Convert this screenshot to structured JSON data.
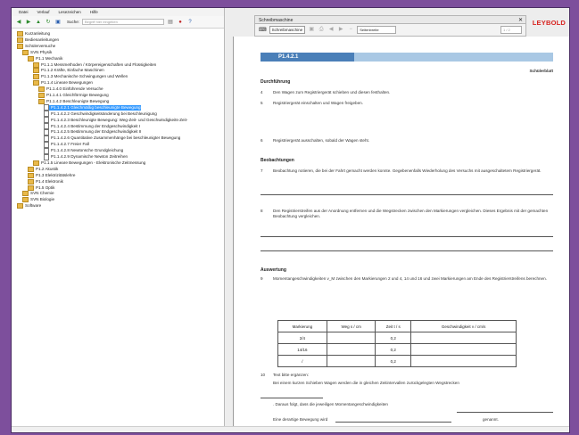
{
  "menu": [
    "Datei",
    "Verlauf",
    "Lesezeichen",
    "Hilfe"
  ],
  "toolbar": {
    "search_label": "Suche:",
    "search_placeholder": "Begriff hier eingeben"
  },
  "tree": [
    {
      "label": "Kurzanleitung",
      "depth": 0,
      "kind": "folder"
    },
    {
      "label": "Bedienanleitungen",
      "depth": 0,
      "kind": "folder"
    },
    {
      "label": "Schülerversuche",
      "depth": 0,
      "kind": "folder"
    },
    {
      "label": "SVN Physik",
      "depth": 1,
      "kind": "folder"
    },
    {
      "label": "P1.1 Mechanik",
      "depth": 2,
      "kind": "folder"
    },
    {
      "label": "P1.1.1 Messmethoden / Körpereigenschaften und Flüssigkeiten",
      "depth": 3,
      "kind": "folder"
    },
    {
      "label": "P1.1.2 Kräfte, Einfache Maschinen",
      "depth": 3,
      "kind": "folder"
    },
    {
      "label": "P1.1.3 Mechanische Schwingungen und Wellen",
      "depth": 3,
      "kind": "folder"
    },
    {
      "label": "P1.1.4 Lineare Bewegungen",
      "depth": 3,
      "kind": "folder"
    },
    {
      "label": "P1.1.4.0 Einführende Versuche",
      "depth": 4,
      "kind": "folder"
    },
    {
      "label": "P1.1.4.1 Gleichförmige Bewegung",
      "depth": 4,
      "kind": "folder"
    },
    {
      "label": "P1.1.4.2 Beschleunigte Bewegung",
      "depth": 4,
      "kind": "folder"
    },
    {
      "label": "P1.1.4.2.1 Gleichmäßig beschleunigte Bewegung",
      "depth": 5,
      "kind": "doc",
      "selected": true
    },
    {
      "label": "P1.1.4.2.2 Geschwindigkeitsänderung bei Beschleunigung",
      "depth": 5,
      "kind": "doc"
    },
    {
      "label": "P1.1.4.2.3 Beschleunigte Bewegung: Weg-Zeit- und Geschwindigkeits-Zeit-",
      "depth": 5,
      "kind": "doc"
    },
    {
      "label": "P1.1.4.2.4 Bestimmung der Endgeschwindigkeit I",
      "depth": 5,
      "kind": "doc"
    },
    {
      "label": "P1.1.4.2.5 Bestimmung der Endgeschwindigkeit II",
      "depth": 5,
      "kind": "doc"
    },
    {
      "label": "P1.1.4.2.6 Quantitative Zusammenhänge bei beschleunigter Bewegung",
      "depth": 5,
      "kind": "doc"
    },
    {
      "label": "P1.1.4.2.7 Freier Fall",
      "depth": 5,
      "kind": "doc"
    },
    {
      "label": "P1.1.4.2.8 Newtonsche Grundgleichung",
      "depth": 5,
      "kind": "doc"
    },
    {
      "label": "P1.1.4.2.9 Dynamische Newton Zeitreihen",
      "depth": 5,
      "kind": "doc"
    },
    {
      "label": "P1.1.5 Lineare Bewegungen - Elektronische Zeitmessung",
      "depth": 3,
      "kind": "folder"
    },
    {
      "label": "P1.2 Akustik",
      "depth": 2,
      "kind": "folder"
    },
    {
      "label": "P1.3 Elektrizitätslehre",
      "depth": 2,
      "kind": "folder"
    },
    {
      "label": "P1.4 Elektronik",
      "depth": 2,
      "kind": "folder"
    },
    {
      "label": "P1.5 Optik",
      "depth": 2,
      "kind": "folder"
    },
    {
      "label": "SVN Chemie",
      "depth": 1,
      "kind": "folder"
    },
    {
      "label": "SVN Biologie",
      "depth": 1,
      "kind": "folder"
    },
    {
      "label": "Software",
      "depth": 0,
      "kind": "folder"
    }
  ],
  "viewer": {
    "title": "Schreibmaschine",
    "save_button": "Schreibmaschine",
    "zoom": "Seitenbreite",
    "page_input": "1 / 2",
    "logo": "LEYBOLD"
  },
  "doc": {
    "code": "P1.4.2.1",
    "sheet_label": "Schülerblatt",
    "sec_durchfuehrung": "Durchführung",
    "step4": "Den Wagen zum Registriergerät schieben und diesen festhalten.",
    "step5": "Registriergerät einschalten und Wagen freigeben.",
    "step6": "Registriergerät ausschalten, sobald der Wagen steht.",
    "sec_beobachtung": "Beobachtungen",
    "step7": "Beobachtung notieren, die bei der Fahrt gemacht werden konnte. Gegebenenfalls Wiederholung des Versuchs mit ausgeschaltetem Registriergerät.",
    "step8": "Den Registrierstreifen aus der Anordnung entfernen und die Wegstrecken zwischen den Markierungen vergleichen. Dieses Ergebnis mit der gemachten Beobachtung vergleichen.",
    "sec_auswertung": "Auswertung",
    "step9": "Momentangeschwindigkeiten v_M zwischen den Markierungen 2 und 4, 14 und 16 und zwei Markierungen am Ende des Registrierstreifens berechnen.",
    "table_headers": [
      "Markierung",
      "Weg s / cm",
      "Zeit t / s",
      "Geschwindigkeit v / cm/s"
    ],
    "table_rows": [
      [
        "2/4",
        "",
        "0,2",
        ""
      ],
      [
        "14/16",
        "",
        "0,2",
        ""
      ],
      [
        "/",
        "",
        "0,2",
        ""
      ]
    ],
    "step10a": "Text bitte ergänzen:",
    "step10b": "Bei einem kurzen Schieben Wagen werden die in gleichen Zeitintervallen zurückgelegten Wegstrecken",
    "line_a": ". Daraus folgt, dass die jeweiligen Momentangeschwindigkeiten",
    "line_b": "Eine derartige Bewegung wird",
    "line_c": "genannt."
  }
}
